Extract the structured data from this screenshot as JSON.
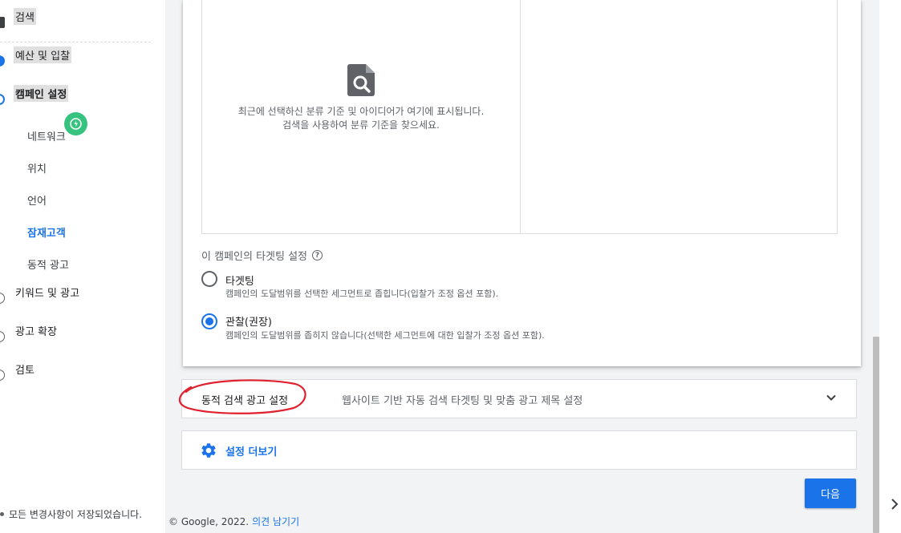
{
  "sidebar": {
    "steps": [
      {
        "label": "검색",
        "state": "search"
      },
      {
        "label": "예산 및 입찰",
        "state": "done"
      },
      {
        "label": "캠페인 설정",
        "state": "current"
      },
      {
        "label": "키워드 및 광고",
        "state": "todo"
      },
      {
        "label": "광고 확장",
        "state": "todo"
      },
      {
        "label": "검토",
        "state": "todo"
      }
    ],
    "substeps": [
      "네트워크",
      "위치",
      "언어",
      "잠재고객",
      "동적 광고"
    ],
    "active_substep": "잠재고객",
    "saved_status": "모든 변경사항이 저장되었습니다."
  },
  "audience_panel": {
    "empty_line1": "최근에 선택하신 분류 기준 및 아이디어가 여기에 표시됩니다.",
    "empty_line2": "검색을 사용하여 분류 기준을 찾으세요."
  },
  "targeting": {
    "title": "이 캠페인의 타겟팅 설정",
    "selected": "observation",
    "options": [
      {
        "id": "targeting",
        "label": "타겟팅",
        "desc": "캠페인의 도달범위를 선택한 세그먼트로 좁힙니다(입찰가 조정 옵션 포함)."
      },
      {
        "id": "observation",
        "label": "관찰(권장)",
        "desc": "캠페인의 도달범위를 좁히지 않습니다(선택한 세그먼트에 대한 입찰가 조정 옵션 포함)."
      }
    ]
  },
  "dsa_row": {
    "title": "동적 검색 광고 설정",
    "desc": "웹사이트 기반 자동 검색 타겟팅 및 맞춤 광고 제목 설정"
  },
  "more_settings": "설정 더보기",
  "next_button": "다음",
  "footer": {
    "copyright": "© Google, 2022.",
    "feedback_link": "의견 남기기"
  },
  "colors": {
    "accent": "#1a73e8",
    "annotation": "#e0202c",
    "badge": "#35c37f"
  }
}
